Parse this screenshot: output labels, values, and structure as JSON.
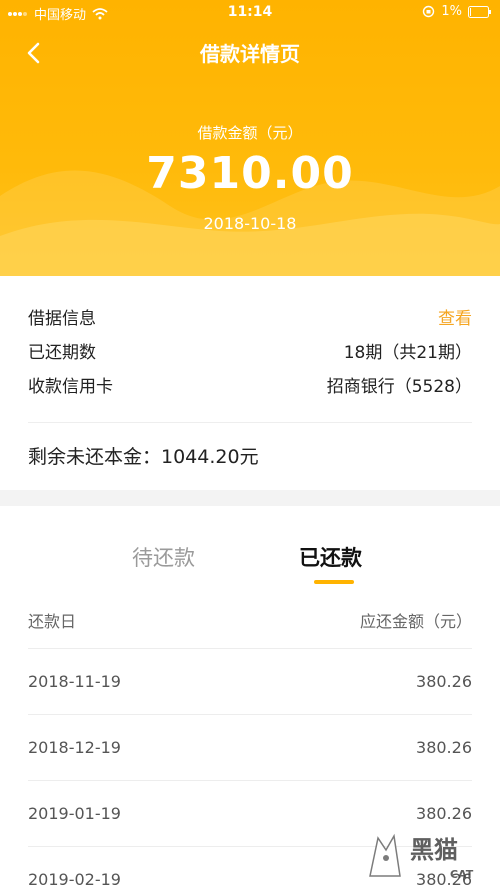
{
  "status_bar": {
    "carrier": "中国移动",
    "time": "11:14",
    "battery": "1%"
  },
  "nav": {
    "title": "借款详情页"
  },
  "loan": {
    "amount_label": "借款金额（元）",
    "amount": "7310.00",
    "date": "2018-10-18"
  },
  "info": {
    "contract_label": "借据信息",
    "contract_action": "查看",
    "paid_periods_label": "已还期数",
    "paid_periods_value": "18期（共21期）",
    "card_label": "收款信用卡",
    "card_value": "招商银行（5528）",
    "remaining_text": "剩余未还本金：1044.20元"
  },
  "tabs": {
    "pending": "待还款",
    "paid": "已还款"
  },
  "table": {
    "col_date": "还款日",
    "col_amount": "应还金额（元）",
    "rows": [
      {
        "date": "2018-11-19",
        "amount": "380.26"
      },
      {
        "date": "2018-12-19",
        "amount": "380.26"
      },
      {
        "date": "2019-01-19",
        "amount": "380.26"
      },
      {
        "date": "2019-02-19",
        "amount": "380.26"
      }
    ]
  },
  "watermark": {
    "text": "黑猫",
    "subtext": "CAT"
  },
  "colors": {
    "header_yellow": "#ffb300",
    "link_orange": "#f5a623",
    "tab_underline": "#ffb300"
  }
}
